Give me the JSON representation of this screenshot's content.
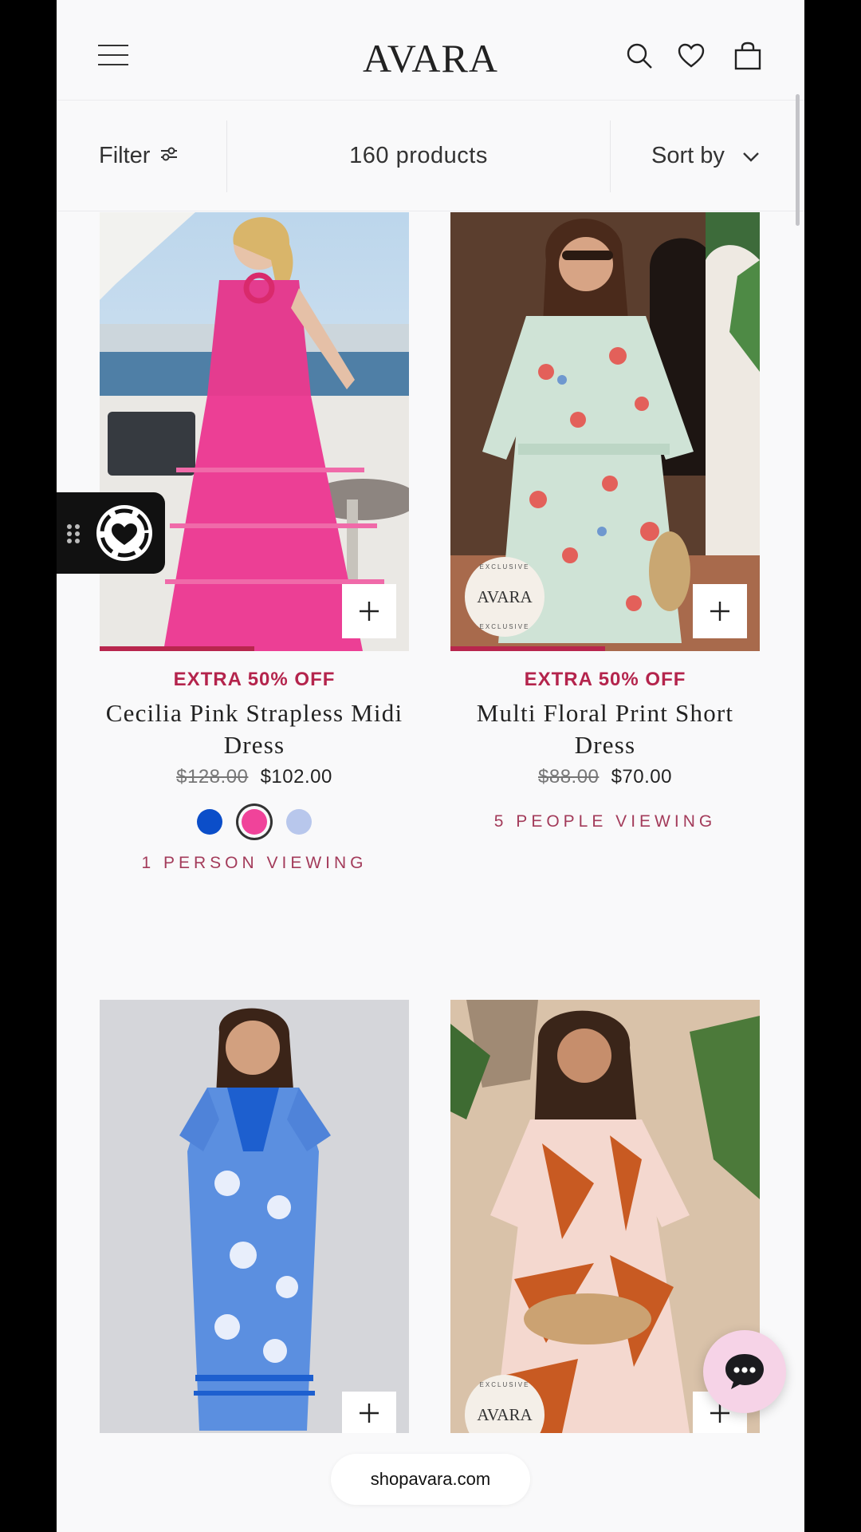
{
  "header": {
    "logo": "AVARA",
    "icons": [
      "menu-icon",
      "search-icon",
      "heart-icon",
      "bag-icon"
    ]
  },
  "toolbar": {
    "filter_label": "Filter",
    "product_count": "160 products",
    "sort_label": "Sort by"
  },
  "products": [
    {
      "promo": "EXTRA 50% OFF",
      "name": "Cecilia Pink Strapless Midi Dress",
      "old_price": "$128.00",
      "price": "$102.00",
      "swatches": [
        "#0b4ec9",
        "#f0439a",
        "#b8c7ec"
      ],
      "selected_swatch": 1,
      "viewing": "1 PERSON VIEWING",
      "image_progress": 0.5
    },
    {
      "promo": "EXTRA 50% OFF",
      "name": "Multi Floral Print Short Dress",
      "old_price": "$88.00",
      "price": "$70.00",
      "badge": {
        "brand": "AVARA",
        "ring": "EXCLUSIVE"
      },
      "viewing": "5 PEOPLE VIEWING",
      "image_progress": 0.5
    },
    {},
    {
      "badge": {
        "brand": "AVARA",
        "ring": "EXCLUSIVE"
      }
    }
  ],
  "footer": {
    "url": "shopavara.com"
  },
  "colors": {
    "accent": "#b4244c",
    "background": "#f9f9fa"
  }
}
